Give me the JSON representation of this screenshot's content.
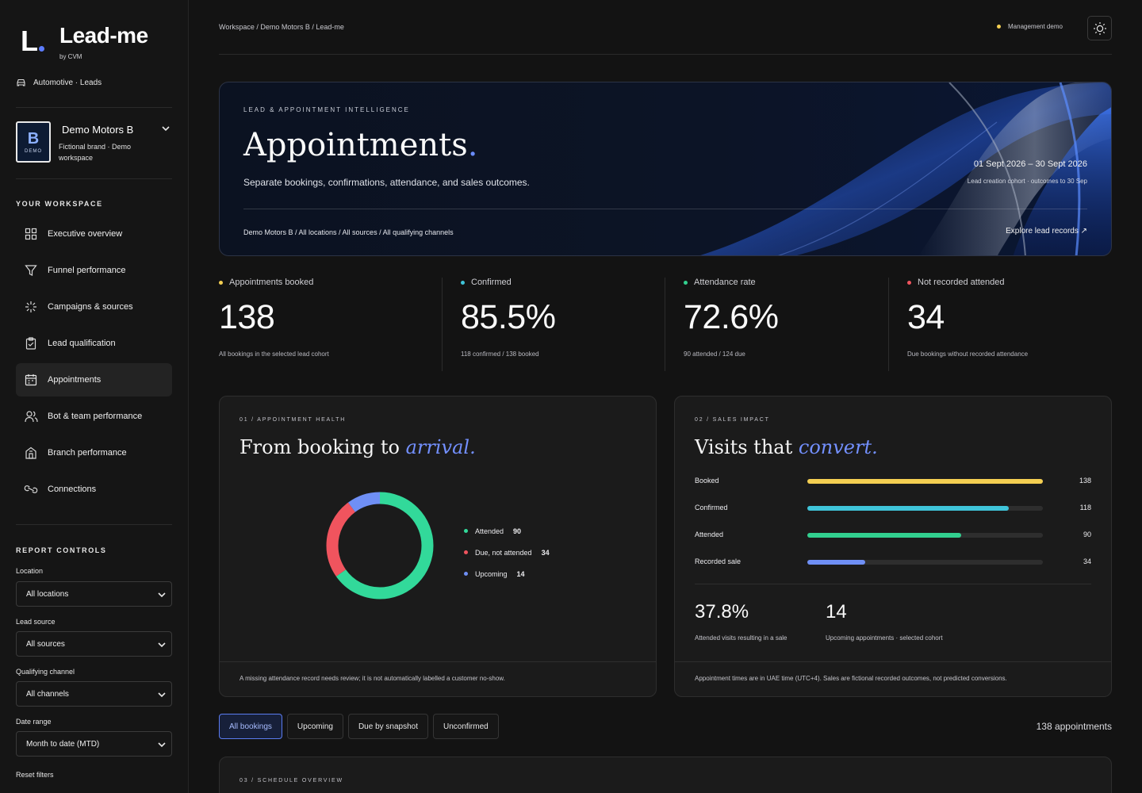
{
  "brand": {
    "logo_letter": "L",
    "title": "Lead-me",
    "by": "by CVM",
    "industry": "Automotive · Leads"
  },
  "workspace_selector": {
    "badge_letter": "B",
    "badge_tag": "DEMO",
    "name": "Demo Motors B",
    "description": "Fictional brand · Demo workspace"
  },
  "nav_section_label": "YOUR WORKSPACE",
  "nav": [
    {
      "label": "Executive overview",
      "icon": "grid-icon"
    },
    {
      "label": "Funnel performance",
      "icon": "funnel-icon"
    },
    {
      "label": "Campaigns & sources",
      "icon": "sparkle-icon"
    },
    {
      "label": "Lead qualification",
      "icon": "clipboard-check-icon"
    },
    {
      "label": "Appointments",
      "icon": "calendar-icon",
      "active": true
    },
    {
      "label": "Bot & team performance",
      "icon": "users-icon"
    },
    {
      "label": "Branch performance",
      "icon": "building-icon"
    },
    {
      "label": "Connections",
      "icon": "link-icon"
    }
  ],
  "controls": {
    "section_label": "REPORT CONTROLS",
    "location": {
      "label": "Location",
      "value": "All locations"
    },
    "lead_source": {
      "label": "Lead source",
      "value": "All sources"
    },
    "channel": {
      "label": "Qualifying channel",
      "value": "All channels"
    },
    "date_range": {
      "label": "Date range",
      "value": "Month to date (MTD)"
    },
    "reset": "Reset filters"
  },
  "topbar": {
    "breadcrumb": "Workspace / Demo Motors B / Lead-me",
    "mode": "Management demo"
  },
  "hero": {
    "eyebrow": "LEAD & APPOINTMENT INTELLIGENCE",
    "title": "Appointments",
    "title_dot": ".",
    "description": "Separate bookings, confirmations, attendance, and sales outcomes.",
    "date_range": "01 Sept 2026 – 30 Sept 2026",
    "cohort": "Lead creation cohort · outcomes to 30 Sep",
    "scope": "Demo Motors B / All locations / All sources / All qualifying channels",
    "link": "Explore lead records ↗"
  },
  "kpis": [
    {
      "label": "Appointments booked",
      "value": "138",
      "desc": "All bookings in the selected lead cohort",
      "color": "#f4cf52"
    },
    {
      "label": "Confirmed",
      "value": "85.5%",
      "desc": "118 confirmed / 138 booked",
      "color": "#3fc4d9"
    },
    {
      "label": "Attendance rate",
      "value": "72.6%",
      "desc": "90 attended / 124 due",
      "color": "#32d08f"
    },
    {
      "label": "Not recorded attended",
      "value": "34",
      "desc": "Due bookings without recorded attendance",
      "color": "#f0545e"
    }
  ],
  "health": {
    "eyebrow": "01 / APPOINTMENT HEALTH",
    "title": "From booking to",
    "title_accent": "arrival.",
    "legend": [
      {
        "label": "Attended",
        "value": "90",
        "count": 90,
        "color": "#32d99a"
      },
      {
        "label": "Due, not attended",
        "value": "34",
        "count": 34,
        "color": "#f0545e"
      },
      {
        "label": "Upcoming",
        "value": "14",
        "count": 14,
        "color": "#6f8ff5"
      }
    ],
    "footnote": "A missing attendance record needs review; it is not automatically labelled a customer no-show."
  },
  "sales": {
    "eyebrow": "02 / SALES IMPACT",
    "title": "Visits that",
    "title_accent": "convert.",
    "bars": [
      {
        "label": "Booked",
        "value": "138",
        "count": 138,
        "color": "#f4cf52"
      },
      {
        "label": "Confirmed",
        "value": "118",
        "count": 118,
        "color": "#3fc4d9"
      },
      {
        "label": "Attended",
        "value": "90",
        "count": 90,
        "color": "#32d08f"
      },
      {
        "label": "Recorded sale",
        "value": "34",
        "count": 34,
        "color": "#6f8ff5"
      }
    ],
    "bar_max": 138,
    "stat1": {
      "value": "37.8%",
      "desc": "Attended visits resulting in a sale"
    },
    "stat2": {
      "value": "14",
      "desc": "Upcoming appointments · selected cohort"
    },
    "footnote": "Appointment times are in UAE time (UTC+4). Sales are fictional recorded outcomes, not predicted conversions."
  },
  "filters": {
    "tabs": [
      {
        "label": "All bookings",
        "active": true
      },
      {
        "label": "Upcoming"
      },
      {
        "label": "Due by snapshot"
      },
      {
        "label": "Unconfirmed"
      }
    ],
    "count": "138 appointments"
  },
  "schedule": {
    "eyebrow": "03 / SCHEDULE OVERVIEW"
  }
}
